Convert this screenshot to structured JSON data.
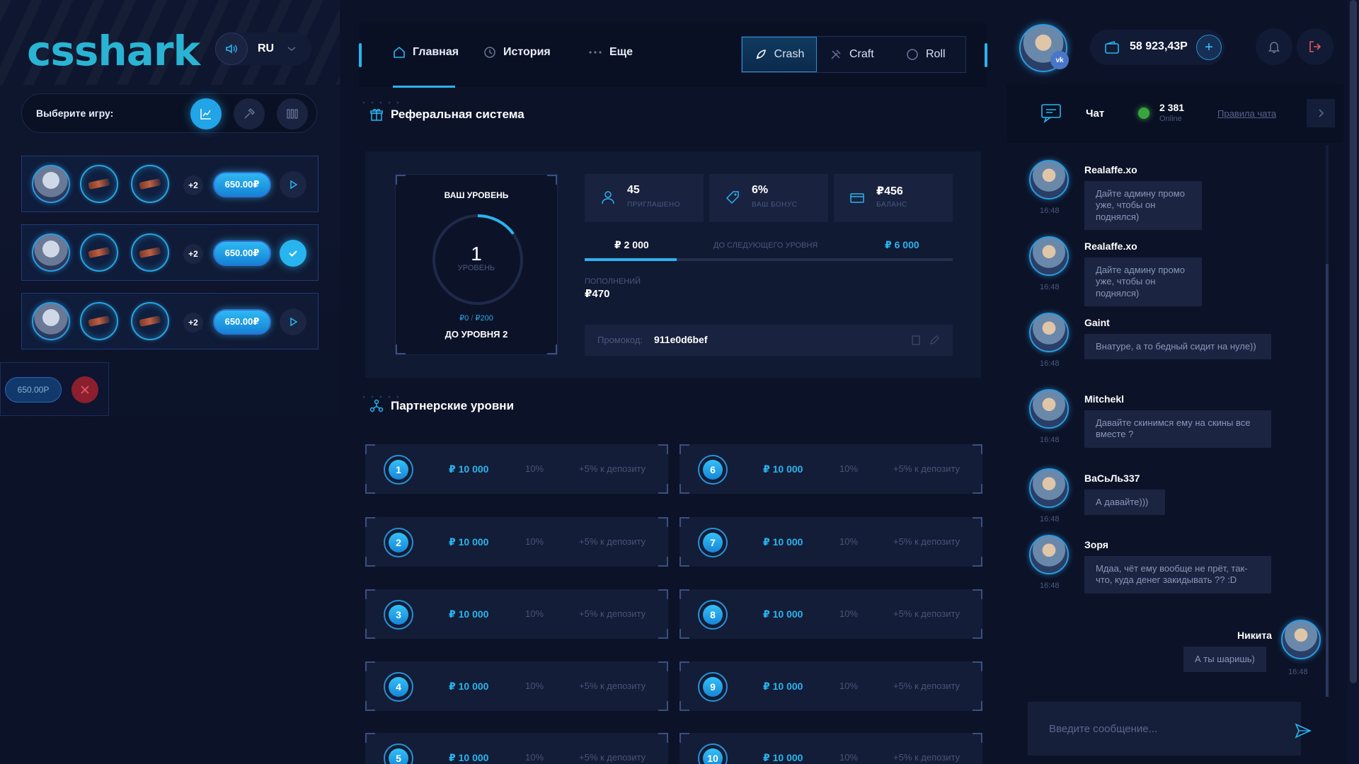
{
  "brand": {
    "logo": "csshark"
  },
  "header": {
    "lang": "RU",
    "balance": "58 923,43Р"
  },
  "nav": {
    "tabs": [
      {
        "label": "Главная",
        "active": true
      },
      {
        "label": "История",
        "active": false
      },
      {
        "label": "Еще",
        "active": false
      }
    ],
    "modes": [
      {
        "label": "Crash",
        "active": true
      },
      {
        "label": "Craft",
        "active": false
      },
      {
        "label": "Roll",
        "active": false
      }
    ]
  },
  "left": {
    "game_select_label": "Выберите игру:",
    "bets": [
      {
        "extra": "+2",
        "amount": "650.00₽",
        "state": "play"
      },
      {
        "extra": "+2",
        "amount": "650.00₽",
        "state": "done"
      },
      {
        "extra": "+2",
        "amount": "650.00₽",
        "state": "play"
      }
    ],
    "mini_bet": {
      "amount": "650.00Р"
    }
  },
  "referral": {
    "title": "Реферальная система",
    "level": {
      "title": "ВАШ УРОВЕНЬ",
      "number": "1",
      "unit": "УРОВЕНЬ",
      "progress_current": "₽0",
      "progress_sep": " / ",
      "progress_target": "₽200",
      "next": "ДО УРОВНЯ 2",
      "ring_fraction": 0.15
    },
    "stats": [
      {
        "value": "45",
        "label": "ПРИГЛАШЕНО",
        "icon": "user-icon"
      },
      {
        "value": "6%",
        "label": "ВАШ БОНУС",
        "icon": "tag-icon"
      },
      {
        "value": "₽456",
        "label": "БАЛАНС",
        "icon": "wallet-icon"
      }
    ],
    "progress": {
      "from": "₽ 2 000",
      "middle": "ДО СЛЕДУЮЩЕГО УРОВНЯ",
      "to": "₽ 6 000",
      "fraction": 0.25
    },
    "deposits_label": "ПОПОЛНЕНИЙ",
    "deposits_value": "₽470",
    "promo_label": "Промокод:",
    "promo_value": "911e0d6bef"
  },
  "partner": {
    "title": "Партнерские уровни",
    "levels": [
      {
        "num": "1",
        "amount": "₽ 10 000",
        "pct": "10%",
        "bonus": "+5% к депозиту"
      },
      {
        "num": "6",
        "amount": "₽ 10 000",
        "pct": "10%",
        "bonus": "+5% к депозиту"
      },
      {
        "num": "2",
        "amount": "₽ 10 000",
        "pct": "10%",
        "bonus": "+5% к депозиту"
      },
      {
        "num": "7",
        "amount": "₽ 10 000",
        "pct": "10%",
        "bonus": "+5% к депозиту"
      },
      {
        "num": "3",
        "amount": "₽ 10 000",
        "pct": "10%",
        "bonus": "+5% к депозиту"
      },
      {
        "num": "8",
        "amount": "₽ 10 000",
        "pct": "10%",
        "bonus": "+5% к депозиту"
      },
      {
        "num": "4",
        "amount": "₽ 10 000",
        "pct": "10%",
        "bonus": "+5% к депозиту"
      },
      {
        "num": "9",
        "amount": "₽ 10 000",
        "pct": "10%",
        "bonus": "+5% к депозиту"
      },
      {
        "num": "5",
        "amount": "₽ 10 000",
        "pct": "10%",
        "bonus": "+5% к депозиту"
      },
      {
        "num": "10",
        "amount": "₽ 10 000",
        "pct": "10%",
        "bonus": "+5% к депозиту"
      }
    ]
  },
  "chat": {
    "title": "Чат",
    "online_count": "2 381",
    "online_label": "Online",
    "rules": "Правила чата",
    "messages": [
      {
        "name": "Realaffe.xo",
        "time": "16:48",
        "text": "Дайте админу промо уже, чтобы он поднялся)"
      },
      {
        "name": "Realaffe.xo",
        "time": "16:48",
        "text": "Дайте админу промо уже, чтобы он поднялся)"
      },
      {
        "name": "Gaint",
        "time": "16:48",
        "text": "Внатуре, а то бедный сидит на нуле))"
      },
      {
        "name": "Mitchekl",
        "time": "16:48",
        "text": "Давайте скинимся ему на скины все вместе ?"
      },
      {
        "name": "ВаСьЛь337",
        "time": "16:48",
        "text": "А давайте)))"
      },
      {
        "name": "Зоря",
        "time": "16:48",
        "text": "Мдаа, чёт ему вообще не прёт, так-что, куда денег закидывать ?? :D"
      }
    ],
    "own_message": {
      "name": "Никита",
      "time": "16:48",
      "text": "А ты шаришь)"
    },
    "input_placeholder": "Введите сообщение..."
  },
  "colors": {
    "accent": "#2ab4ef",
    "background": "#0c1328",
    "panel": "#111a33",
    "danger": "#8b1f2e",
    "online": "#3aa53e"
  }
}
